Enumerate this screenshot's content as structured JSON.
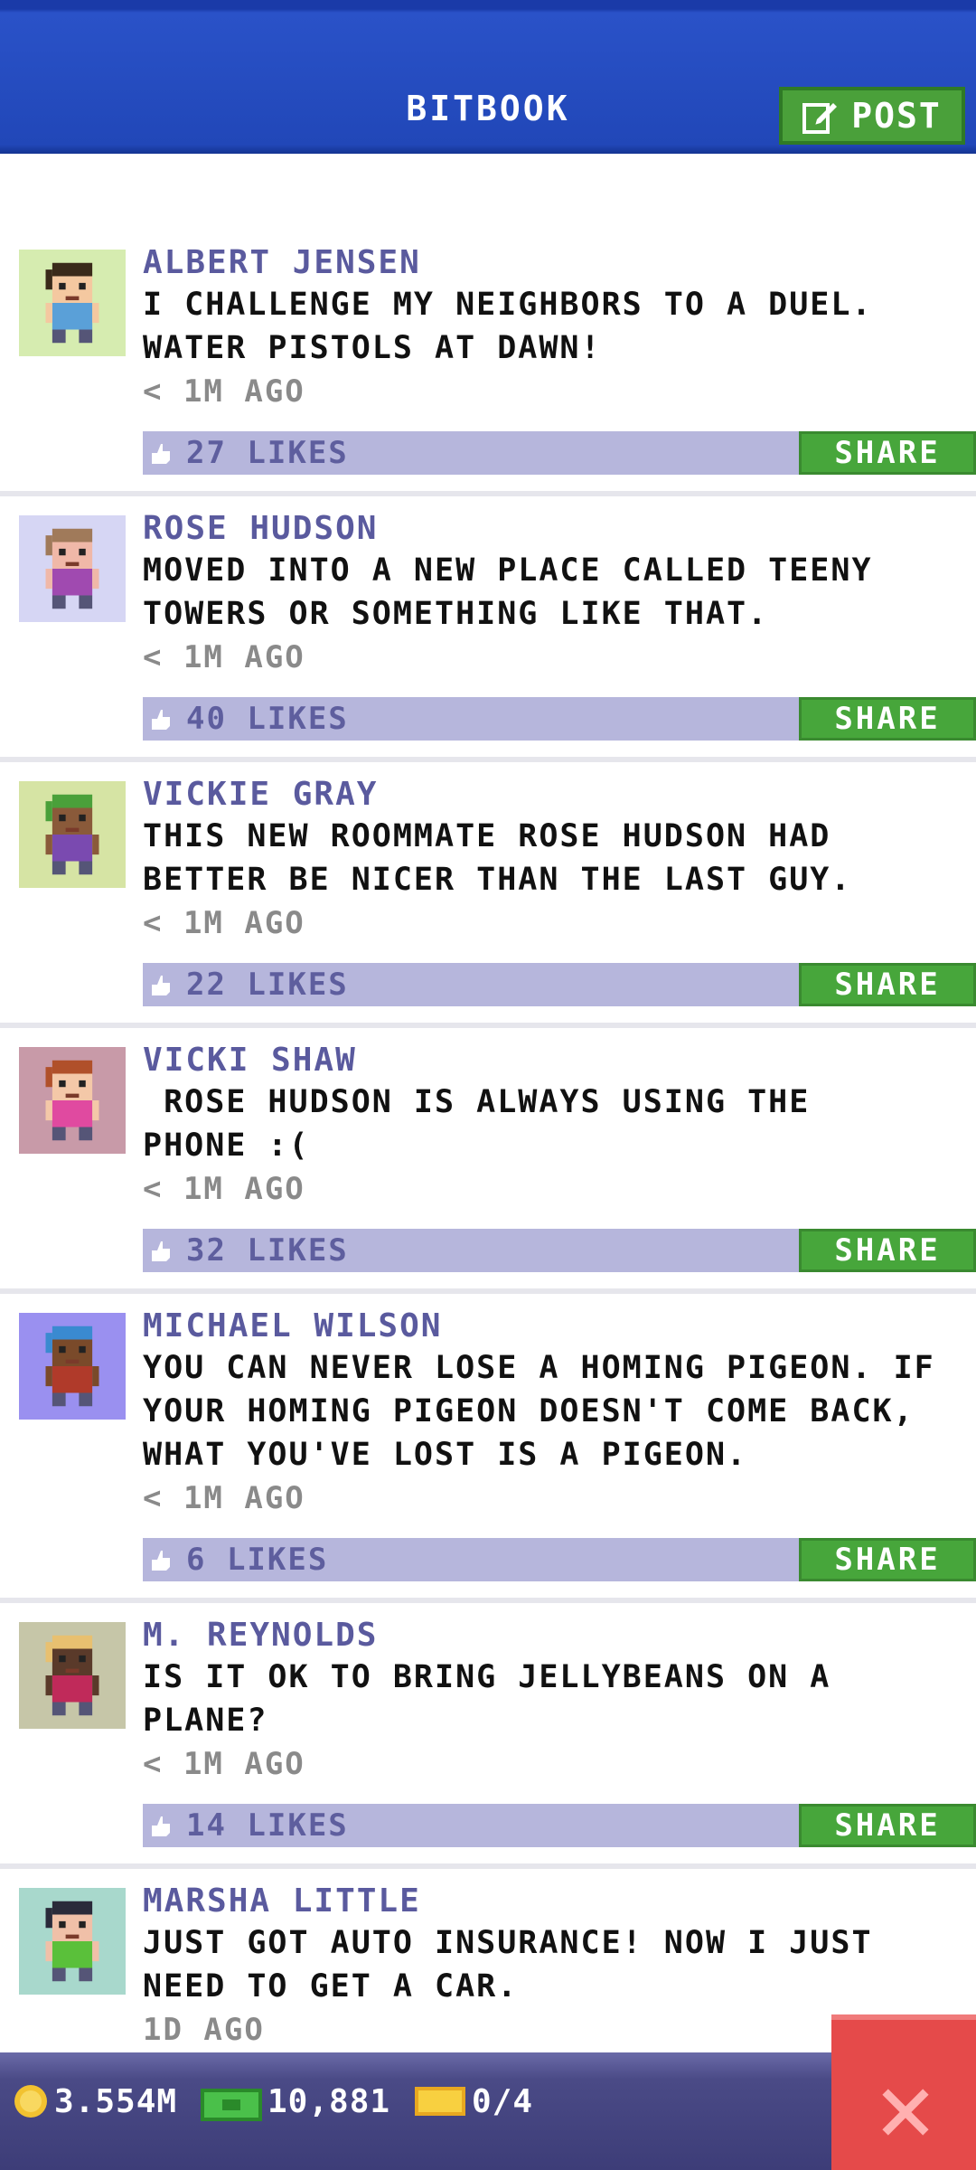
{
  "header": {
    "title": "BITBOOK",
    "post_label": "POST"
  },
  "posts": [
    {
      "name": "ALBERT JENSEN",
      "lines": [
        "I CHALLENGE MY NEIGHBORS TO A DUEL.",
        "WATER PISTOLS AT DAWN!"
      ],
      "time": "< 1M AGO",
      "likes": "27 LIKES",
      "share": "SHARE",
      "avatar_bg": "#d6ecb0",
      "hair": "#3a2a1a",
      "shirt": "#5aa0d8",
      "skin": "#f4c8a0"
    },
    {
      "name": "ROSE HUDSON",
      "lines": [
        "MOVED INTO A NEW PLACE CALLED TEENY",
        "TOWERS OR SOMETHING LIKE THAT."
      ],
      "time": "< 1M AGO",
      "likes": "40 LIKES",
      "share": "SHARE",
      "avatar_bg": "#d6d6f4",
      "hair": "#a07a5a",
      "shirt": "#a04ab0",
      "skin": "#f0b8a8"
    },
    {
      "name": "VICKIE GRAY",
      "lines": [
        "THIS NEW ROOMMATE ROSE HUDSON HAD",
        "BETTER BE NICER THAN THE LAST GUY."
      ],
      "time": "< 1M AGO",
      "likes": "22 LIKES",
      "share": "SHARE",
      "avatar_bg": "#d6e4a4",
      "hair": "#4aa03a",
      "shirt": "#7a4ab0",
      "skin": "#8a5a3a"
    },
    {
      "name": "VICKI SHAW",
      "lines": [
        " ROSE HUDSON IS ALWAYS USING THE",
        "PHONE :("
      ],
      "time": "< 1M AGO",
      "likes": "32 LIKES",
      "share": "SHARE",
      "avatar_bg": "#c89aa8",
      "hair": "#b0502a",
      "shirt": "#e04aa0",
      "skin": "#f4c8a8"
    },
    {
      "name": "MICHAEL WILSON",
      "lines": [
        "YOU CAN NEVER LOSE A HOMING PIGEON. IF",
        "YOUR HOMING PIGEON DOESN'T COME BACK,",
        "WHAT YOU'VE LOST IS A PIGEON."
      ],
      "time": "< 1M AGO",
      "likes": "6 LIKES",
      "share": "SHARE",
      "avatar_bg": "#9a90f0",
      "hair": "#3a8ad0",
      "shirt": "#b03a2a",
      "skin": "#7a4a2a"
    },
    {
      "name": "M. REYNOLDS",
      "lines": [
        "IS IT OK TO BRING JELLYBEANS ON A",
        "PLANE?"
      ],
      "time": "< 1M AGO",
      "likes": "14 LIKES",
      "share": "SHARE",
      "avatar_bg": "#c6c6a8",
      "hair": "#e8c070",
      "shirt": "#c02a5a",
      "skin": "#5a3a2a"
    },
    {
      "name": "MARSHA LITTLE",
      "lines": [
        "JUST GOT AUTO INSURANCE! NOW I JUST",
        "NEED TO GET A CAR."
      ],
      "time": "1D AGO",
      "likes": "",
      "share": "",
      "avatar_bg": "#a8d8cc",
      "hair": "#2a2a3a",
      "shirt": "#5ac03a",
      "skin": "#f0c0a8"
    }
  ],
  "bottom": {
    "coins": "3.554M",
    "bux": "10,881",
    "tickets": "0/4"
  },
  "colors": {
    "header": "#2147b8",
    "share": "#47a63b",
    "like_bar": "#b6b6dc",
    "close": "#e54a4a"
  }
}
